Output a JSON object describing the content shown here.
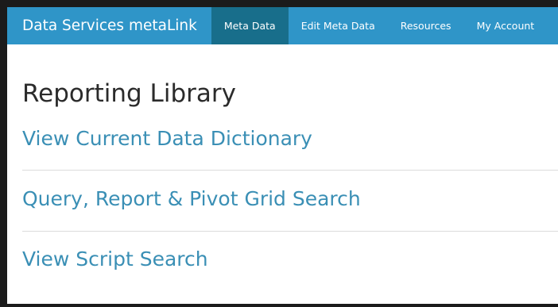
{
  "navbar": {
    "brand": "Data Services metaLink",
    "items": [
      {
        "label": "Meta Data",
        "active": true
      },
      {
        "label": "Edit Meta Data",
        "active": false
      },
      {
        "label": "Resources",
        "active": false
      },
      {
        "label": "My Account",
        "active": false
      }
    ]
  },
  "main": {
    "title": "Reporting Library",
    "links": [
      {
        "label": "View Current Data Dictionary"
      },
      {
        "label": "Query, Report & Pivot Grid Search"
      },
      {
        "label": "View Script Search"
      }
    ]
  },
  "colors": {
    "navbar_bg": "#2f95c8",
    "nav_active_bg": "#186e8b",
    "link": "#3a8fb5",
    "title": "#2b2b2b"
  }
}
